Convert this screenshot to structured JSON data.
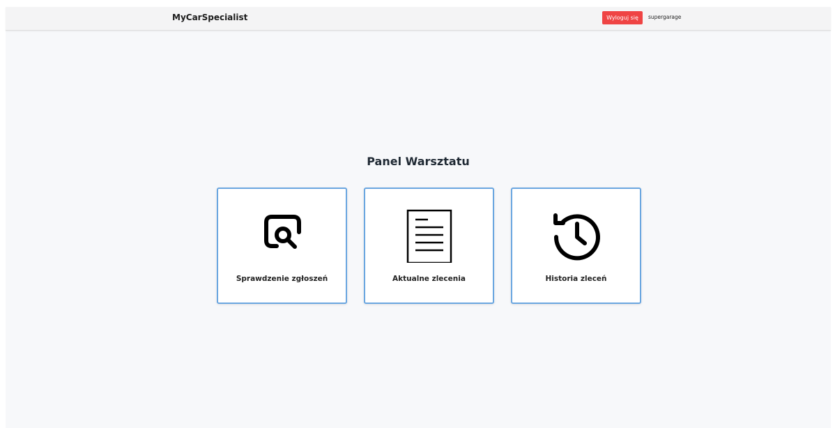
{
  "header": {
    "brand": "MyCarSpecialist",
    "logout_label": "Wyloguj się",
    "username": "supergarage"
  },
  "main": {
    "title": "Panel Warsztatu",
    "cards": [
      {
        "label": "Sprawdzenie zgłoszeń",
        "icon": "search-document-icon"
      },
      {
        "label": "Aktualne zlecenia",
        "icon": "document-list-icon"
      },
      {
        "label": "Historia zleceń",
        "icon": "history-icon"
      }
    ]
  },
  "colors": {
    "logout_button": "#ef4444",
    "card_border": "#6aa6e0",
    "background": "#f7f8fa"
  }
}
